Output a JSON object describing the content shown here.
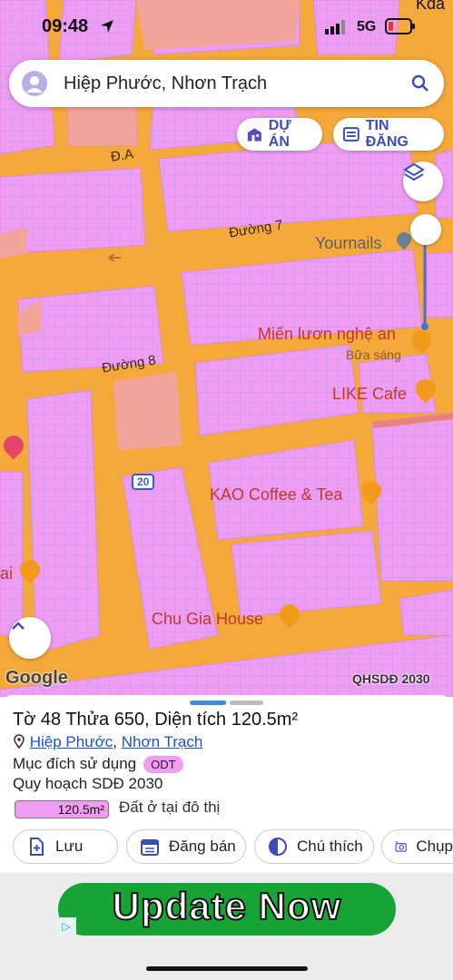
{
  "status_bar": {
    "time": "09:48",
    "network": "5G",
    "corner_text": "Kđa"
  },
  "search": {
    "query": "Hiệp Phước, Nhơn Trạch"
  },
  "chips": [
    {
      "label": "DỰ ÁN",
      "icon": "building-icon"
    },
    {
      "label": "TIN ĐĂNG",
      "icon": "list-icon"
    }
  ],
  "map": {
    "street_labels": [
      "Đ.A",
      "Đường 7",
      "Đường 8"
    ],
    "places": [
      {
        "name": "Yournails",
        "icon": "location-pin-icon"
      },
      {
        "name": "Miến lươn nghệ an",
        "subtitle": "Bữa sáng",
        "icon": "restaurant-icon"
      },
      {
        "name": "LIKE Cafe",
        "icon": "cafe-icon"
      },
      {
        "name": "KAO Coffee & Tea",
        "icon": "cafe-icon"
      },
      {
        "name": "Chu Gia House",
        "icon": "cafe-icon"
      }
    ],
    "route_badge": "20",
    "partial_label_left": "ai",
    "attribution": "Google",
    "layer_name": "QHSDĐ 2030"
  },
  "parcel": {
    "title": "Tờ 48 Thửa 650, Diện tích 120.5m²",
    "location_links": [
      "Hiệp Phước",
      "Nhơn Trạch"
    ],
    "location_separator": ",",
    "purpose_label": "Mục đích sử dụng",
    "purpose_code": "ODT",
    "plan_label": "Quy hoạch SDĐ 2030",
    "plan_area": "120.5m²",
    "plan_description": "Đất ở tại đô thị"
  },
  "actions": [
    {
      "label": "Lưu",
      "icon": "add-document-icon"
    },
    {
      "label": "Đăng bán",
      "icon": "calendar-icon"
    },
    {
      "label": "Chú thích",
      "icon": "half-circle-icon"
    },
    {
      "label": "Chụp",
      "icon": "camera-icon"
    }
  ],
  "ad": {
    "text": "Update Now"
  },
  "colors": {
    "road": "#f5a93a",
    "residential": "#f09cf3",
    "accent": "#3b4db8",
    "link": "#1d4fd8",
    "poi": "#f29a1a"
  }
}
